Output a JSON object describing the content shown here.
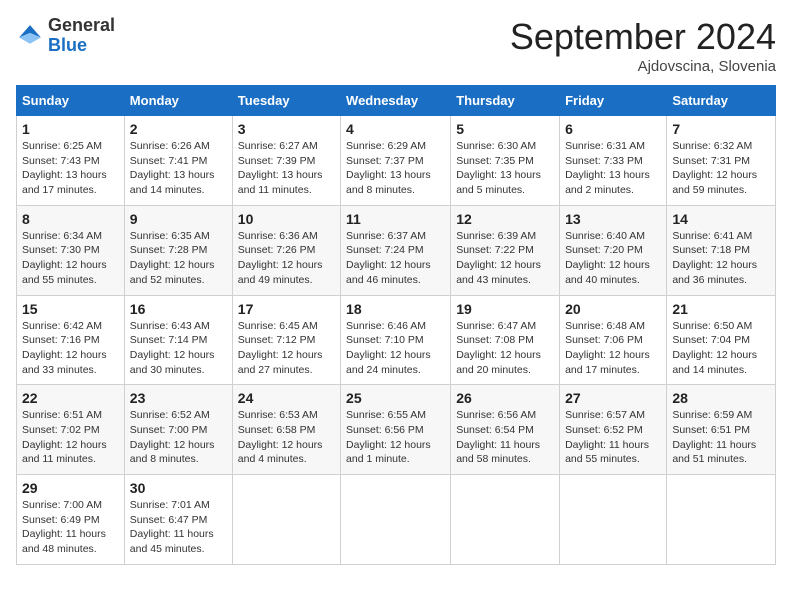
{
  "header": {
    "logo_general": "General",
    "logo_blue": "Blue",
    "month": "September 2024",
    "location": "Ajdovscina, Slovenia"
  },
  "weekdays": [
    "Sunday",
    "Monday",
    "Tuesday",
    "Wednesday",
    "Thursday",
    "Friday",
    "Saturday"
  ],
  "weeks": [
    [
      {
        "day": "1",
        "sunrise": "Sunrise: 6:25 AM",
        "sunset": "Sunset: 7:43 PM",
        "daylight": "Daylight: 13 hours and 17 minutes."
      },
      {
        "day": "2",
        "sunrise": "Sunrise: 6:26 AM",
        "sunset": "Sunset: 7:41 PM",
        "daylight": "Daylight: 13 hours and 14 minutes."
      },
      {
        "day": "3",
        "sunrise": "Sunrise: 6:27 AM",
        "sunset": "Sunset: 7:39 PM",
        "daylight": "Daylight: 13 hours and 11 minutes."
      },
      {
        "day": "4",
        "sunrise": "Sunrise: 6:29 AM",
        "sunset": "Sunset: 7:37 PM",
        "daylight": "Daylight: 13 hours and 8 minutes."
      },
      {
        "day": "5",
        "sunrise": "Sunrise: 6:30 AM",
        "sunset": "Sunset: 7:35 PM",
        "daylight": "Daylight: 13 hours and 5 minutes."
      },
      {
        "day": "6",
        "sunrise": "Sunrise: 6:31 AM",
        "sunset": "Sunset: 7:33 PM",
        "daylight": "Daylight: 13 hours and 2 minutes."
      },
      {
        "day": "7",
        "sunrise": "Sunrise: 6:32 AM",
        "sunset": "Sunset: 7:31 PM",
        "daylight": "Daylight: 12 hours and 59 minutes."
      }
    ],
    [
      {
        "day": "8",
        "sunrise": "Sunrise: 6:34 AM",
        "sunset": "Sunset: 7:30 PM",
        "daylight": "Daylight: 12 hours and 55 minutes."
      },
      {
        "day": "9",
        "sunrise": "Sunrise: 6:35 AM",
        "sunset": "Sunset: 7:28 PM",
        "daylight": "Daylight: 12 hours and 52 minutes."
      },
      {
        "day": "10",
        "sunrise": "Sunrise: 6:36 AM",
        "sunset": "Sunset: 7:26 PM",
        "daylight": "Daylight: 12 hours and 49 minutes."
      },
      {
        "day": "11",
        "sunrise": "Sunrise: 6:37 AM",
        "sunset": "Sunset: 7:24 PM",
        "daylight": "Daylight: 12 hours and 46 minutes."
      },
      {
        "day": "12",
        "sunrise": "Sunrise: 6:39 AM",
        "sunset": "Sunset: 7:22 PM",
        "daylight": "Daylight: 12 hours and 43 minutes."
      },
      {
        "day": "13",
        "sunrise": "Sunrise: 6:40 AM",
        "sunset": "Sunset: 7:20 PM",
        "daylight": "Daylight: 12 hours and 40 minutes."
      },
      {
        "day": "14",
        "sunrise": "Sunrise: 6:41 AM",
        "sunset": "Sunset: 7:18 PM",
        "daylight": "Daylight: 12 hours and 36 minutes."
      }
    ],
    [
      {
        "day": "15",
        "sunrise": "Sunrise: 6:42 AM",
        "sunset": "Sunset: 7:16 PM",
        "daylight": "Daylight: 12 hours and 33 minutes."
      },
      {
        "day": "16",
        "sunrise": "Sunrise: 6:43 AM",
        "sunset": "Sunset: 7:14 PM",
        "daylight": "Daylight: 12 hours and 30 minutes."
      },
      {
        "day": "17",
        "sunrise": "Sunrise: 6:45 AM",
        "sunset": "Sunset: 7:12 PM",
        "daylight": "Daylight: 12 hours and 27 minutes."
      },
      {
        "day": "18",
        "sunrise": "Sunrise: 6:46 AM",
        "sunset": "Sunset: 7:10 PM",
        "daylight": "Daylight: 12 hours and 24 minutes."
      },
      {
        "day": "19",
        "sunrise": "Sunrise: 6:47 AM",
        "sunset": "Sunset: 7:08 PM",
        "daylight": "Daylight: 12 hours and 20 minutes."
      },
      {
        "day": "20",
        "sunrise": "Sunrise: 6:48 AM",
        "sunset": "Sunset: 7:06 PM",
        "daylight": "Daylight: 12 hours and 17 minutes."
      },
      {
        "day": "21",
        "sunrise": "Sunrise: 6:50 AM",
        "sunset": "Sunset: 7:04 PM",
        "daylight": "Daylight: 12 hours and 14 minutes."
      }
    ],
    [
      {
        "day": "22",
        "sunrise": "Sunrise: 6:51 AM",
        "sunset": "Sunset: 7:02 PM",
        "daylight": "Daylight: 12 hours and 11 minutes."
      },
      {
        "day": "23",
        "sunrise": "Sunrise: 6:52 AM",
        "sunset": "Sunset: 7:00 PM",
        "daylight": "Daylight: 12 hours and 8 minutes."
      },
      {
        "day": "24",
        "sunrise": "Sunrise: 6:53 AM",
        "sunset": "Sunset: 6:58 PM",
        "daylight": "Daylight: 12 hours and 4 minutes."
      },
      {
        "day": "25",
        "sunrise": "Sunrise: 6:55 AM",
        "sunset": "Sunset: 6:56 PM",
        "daylight": "Daylight: 12 hours and 1 minute."
      },
      {
        "day": "26",
        "sunrise": "Sunrise: 6:56 AM",
        "sunset": "Sunset: 6:54 PM",
        "daylight": "Daylight: 11 hours and 58 minutes."
      },
      {
        "day": "27",
        "sunrise": "Sunrise: 6:57 AM",
        "sunset": "Sunset: 6:52 PM",
        "daylight": "Daylight: 11 hours and 55 minutes."
      },
      {
        "day": "28",
        "sunrise": "Sunrise: 6:59 AM",
        "sunset": "Sunset: 6:51 PM",
        "daylight": "Daylight: 11 hours and 51 minutes."
      }
    ],
    [
      {
        "day": "29",
        "sunrise": "Sunrise: 7:00 AM",
        "sunset": "Sunset: 6:49 PM",
        "daylight": "Daylight: 11 hours and 48 minutes."
      },
      {
        "day": "30",
        "sunrise": "Sunrise: 7:01 AM",
        "sunset": "Sunset: 6:47 PM",
        "daylight": "Daylight: 11 hours and 45 minutes."
      },
      null,
      null,
      null,
      null,
      null
    ]
  ]
}
